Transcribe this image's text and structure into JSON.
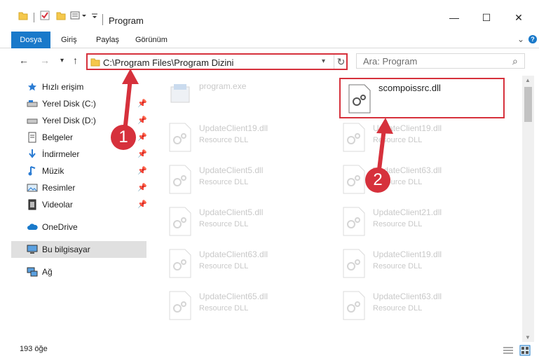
{
  "window": {
    "title": "Program",
    "controls": {
      "minimize": "—",
      "maximize": "☐",
      "close": "✕"
    }
  },
  "ribbon": {
    "tabs": [
      "Dosya",
      "Giriş",
      "Paylaş",
      "Görünüm"
    ],
    "expand": "⌄",
    "help": "?"
  },
  "nav": {
    "back": "←",
    "forward": "→",
    "recent": "▾",
    "up": "↑"
  },
  "address": {
    "path": "C:\\Program Files\\Program Dizini",
    "dropdown": "▾",
    "refresh": "↻"
  },
  "search": {
    "placeholder": "Ara: Program",
    "icon": "⌕"
  },
  "sidebar": {
    "items": [
      {
        "label": "Hızlı erişim",
        "icon": "star-icon",
        "pinned": false
      },
      {
        "label": "Yerel Disk (C:)",
        "icon": "drive-icon",
        "pinned": true
      },
      {
        "label": "Yerel Disk (D:)",
        "icon": "drive-icon",
        "pinned": true
      },
      {
        "label": "Belgeler",
        "icon": "documents-icon",
        "pinned": true
      },
      {
        "label": "İndirmeler",
        "icon": "download-icon",
        "pinned": true
      },
      {
        "label": "Müzik",
        "icon": "music-icon",
        "pinned": true
      },
      {
        "label": "Resimler",
        "icon": "pictures-icon",
        "pinned": true
      },
      {
        "label": "Videolar",
        "icon": "videos-icon",
        "pinned": true
      },
      {
        "label": "OneDrive",
        "icon": "cloud-icon",
        "pinned": false
      },
      {
        "label": "Bu bilgisayar",
        "icon": "computer-icon",
        "pinned": false,
        "selected": true
      },
      {
        "label": "Ağ",
        "icon": "network-icon",
        "pinned": false
      }
    ]
  },
  "files": {
    "left": [
      {
        "name": "program.exe",
        "type": ""
      },
      {
        "name": "UpdateClient19.dll",
        "type": "Resource DLL"
      },
      {
        "name": "UpdateClient5.dll",
        "type": "Resource DLL"
      },
      {
        "name": "UpdateClient5.dll",
        "type": "Resource DLL"
      },
      {
        "name": "UpdateClient63.dll",
        "type": "Resource DLL"
      },
      {
        "name": "UpdateClient65.dll",
        "type": "Resource DLL"
      }
    ],
    "right": [
      {
        "name": "scompoissrc.dll",
        "type": ""
      },
      {
        "name": "UpdateClient19.dll",
        "type": "Resource DLL"
      },
      {
        "name": "UpdateClient63.dll",
        "type": "Resource DLL"
      },
      {
        "name": "UpdateClient21.dll",
        "type": "Resource DLL"
      },
      {
        "name": "UpdateClient19.dll",
        "type": "Resource DLL"
      },
      {
        "name": "UpdateClient63.dll",
        "type": "Resource DLL"
      }
    ]
  },
  "status": {
    "count": "193 öğe"
  },
  "annotations": {
    "step1": "1",
    "step2": "2",
    "color": "#d6313c"
  },
  "colors": {
    "accent": "#1979ca",
    "highlight": "#d6313c"
  }
}
